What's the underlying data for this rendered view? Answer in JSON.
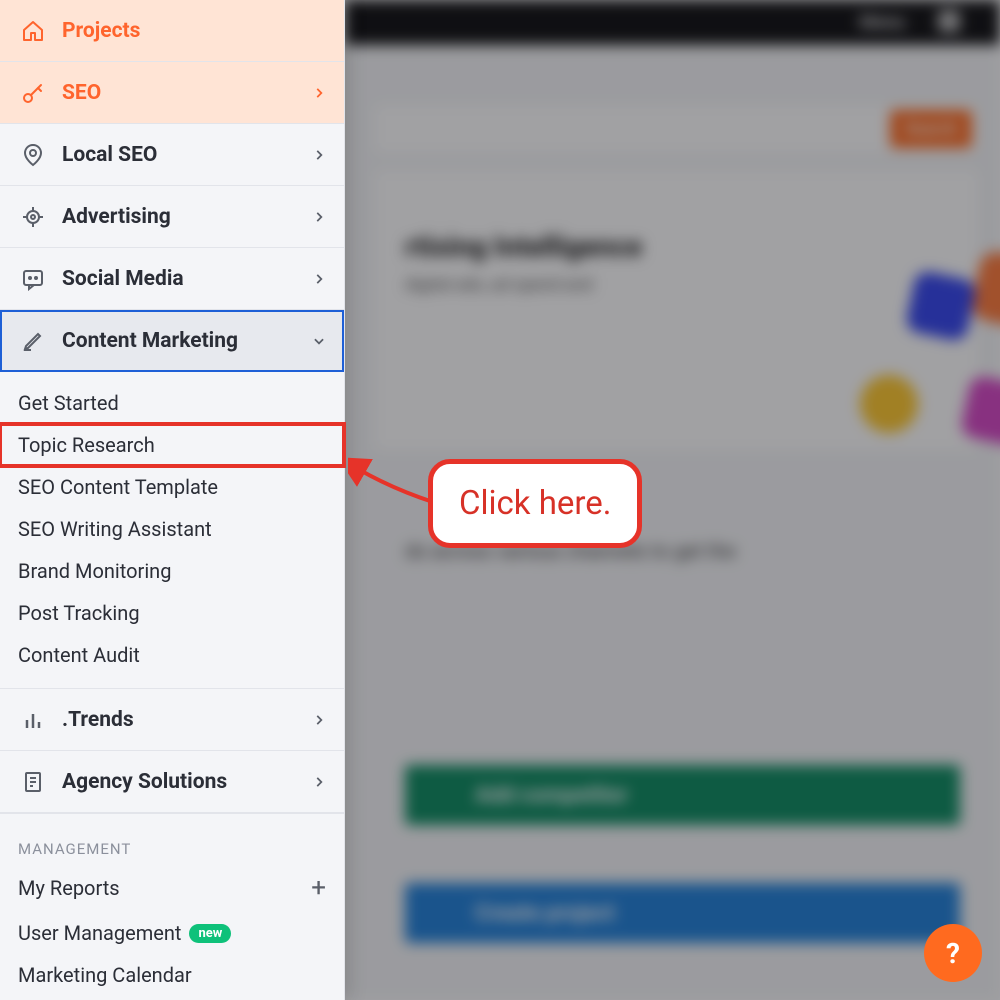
{
  "sidebar": {
    "projects_label": "Projects",
    "seo_label": "SEO",
    "local_seo_label": "Local SEO",
    "advertising_label": "Advertising",
    "social_media_label": "Social Media",
    "content_marketing_label": "Content Marketing",
    "trends_label": ".Trends",
    "agency_label": "Agency Solutions"
  },
  "content_marketing_sub": {
    "get_started": "Get Started",
    "topic_research": "Topic Research",
    "seo_content_template": "SEO Content Template",
    "seo_writing_assistant": "SEO Writing Assistant",
    "brand_monitoring": "Brand Monitoring",
    "post_tracking": "Post Tracking",
    "content_audit": "Content Audit"
  },
  "management": {
    "section_label": "MANAGEMENT",
    "my_reports": "My Reports",
    "user_management": "User Management",
    "user_management_badge": "new",
    "marketing_calendar": "Marketing Calendar"
  },
  "background": {
    "menu_label": "Menu",
    "search_btn": "Search",
    "hero_title": "rtising Intelligence",
    "hero_sub": "digital ads, ad spend and",
    "paragraph": "ds across various channels to get the",
    "green_btn": "Add competitor",
    "blue_btn": "Create project",
    "help": "?"
  },
  "annotation": {
    "callout_text": "Click here."
  }
}
